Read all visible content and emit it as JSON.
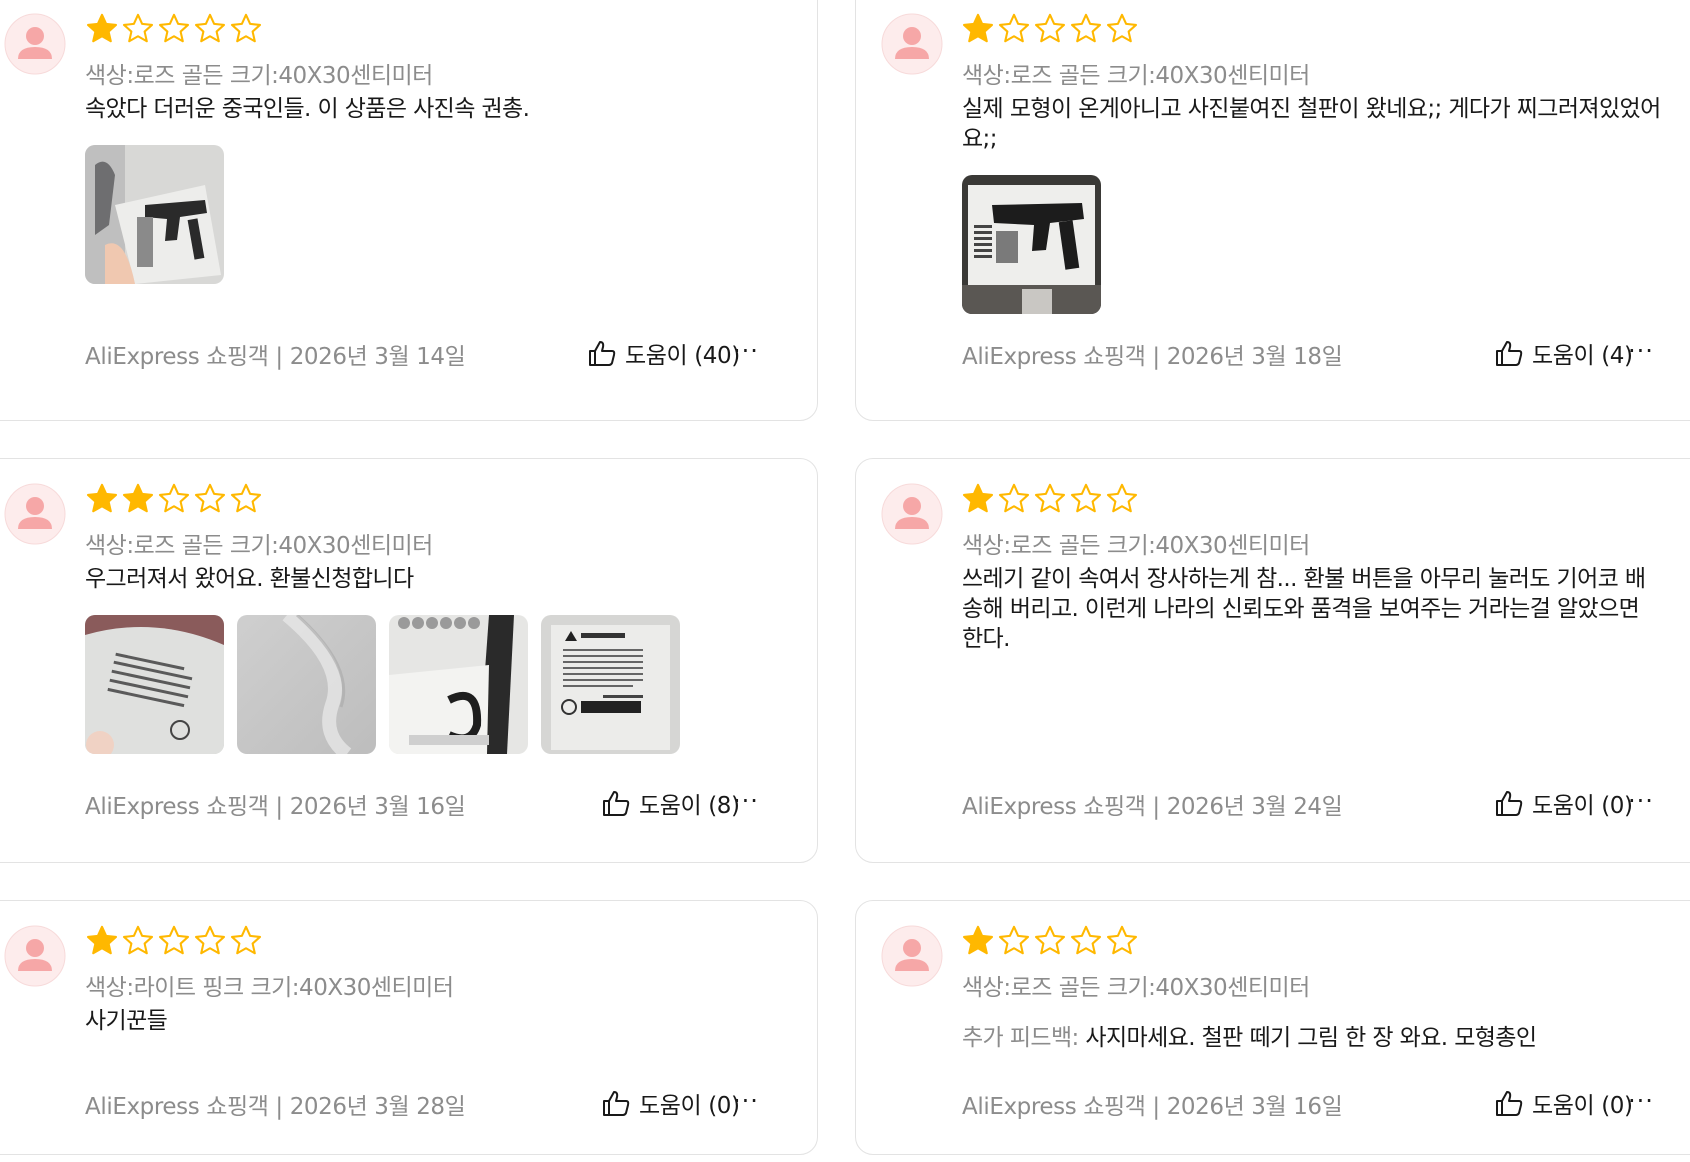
{
  "colors": {
    "star_filled": "#ffb800",
    "star_empty": "#ffb800",
    "meta_text": "#8c8c8c",
    "avatar_bg": "#fdecec",
    "avatar_fg": "#f6a7a7"
  },
  "reviews": [
    {
      "rating": 1,
      "sku": "색상:로즈 골든 크기:40X30센티미터",
      "feedback_label": "",
      "text": "속았다 더러운 중국인들. 이 상품은 사진속 권총.",
      "photos": [
        "photo-gun-sign-held"
      ],
      "reviewer": "AliExpress 쇼핑객",
      "date": "2026년 3월 14일",
      "helpful": "도움이 (40)",
      "more": "···"
    },
    {
      "rating": 1,
      "sku": "색상:로즈 골든 크기:40X30센티미터",
      "feedback_label": "",
      "text": "실제 모형이 온게아니고 사진붙여진 철판이 왔네요;; 게다가 찌그러져있었어요;;",
      "photos": [
        "photo-gun-sign-flat"
      ],
      "reviewer": "AliExpress 쇼핑객",
      "date": "2026년 3월 18일",
      "helpful": "도움이 (4)",
      "more": "···"
    },
    {
      "rating": 2,
      "sku": "색상:로즈 골든 크기:40X30센티미터",
      "feedback_label": "",
      "text": "우그러져서 왔어요. 환불신청합니다",
      "photos": [
        "photo-warning-bag",
        "photo-dented-sheet",
        "photo-gun-closeup",
        "photo-warning-label"
      ],
      "reviewer": "AliExpress 쇼핑객",
      "date": "2026년 3월 16일",
      "helpful": "도움이 (8)",
      "more": "···"
    },
    {
      "rating": 1,
      "sku": "색상:로즈 골든 크기:40X30센티미터",
      "feedback_label": "",
      "text": "쓰레기 같이 속여서 장사하는게 참... 환불 버튼을 아무리 눌러도 기어코 배송해 버리고. 이런게 나라의 신뢰도와 품격을 보여주는 거라는걸 알았으면 한다.",
      "photos": [],
      "reviewer": "AliExpress 쇼핑객",
      "date": "2026년 3월 24일",
      "helpful": "도움이 (0)",
      "more": "···"
    },
    {
      "rating": 1,
      "sku": "색상:라이트 핑크 크기:40X30센티미터",
      "feedback_label": "",
      "text": "사기꾼들",
      "photos": [],
      "reviewer": "AliExpress 쇼핑객",
      "date": "2026년 3월 28일",
      "helpful": "도움이 (0)",
      "more": "···"
    },
    {
      "rating": 1,
      "sku": "색상:로즈 골든 크기:40X30센티미터",
      "feedback_label": "추가 피드백:",
      "text": "사지마세요. 철판 떼기 그림 한 장 와요. 모형총인",
      "photos": [],
      "reviewer": "AliExpress 쇼핑객",
      "date": "2026년 3월 16일",
      "helpful": "도움이 (0)",
      "more": "···"
    }
  ]
}
